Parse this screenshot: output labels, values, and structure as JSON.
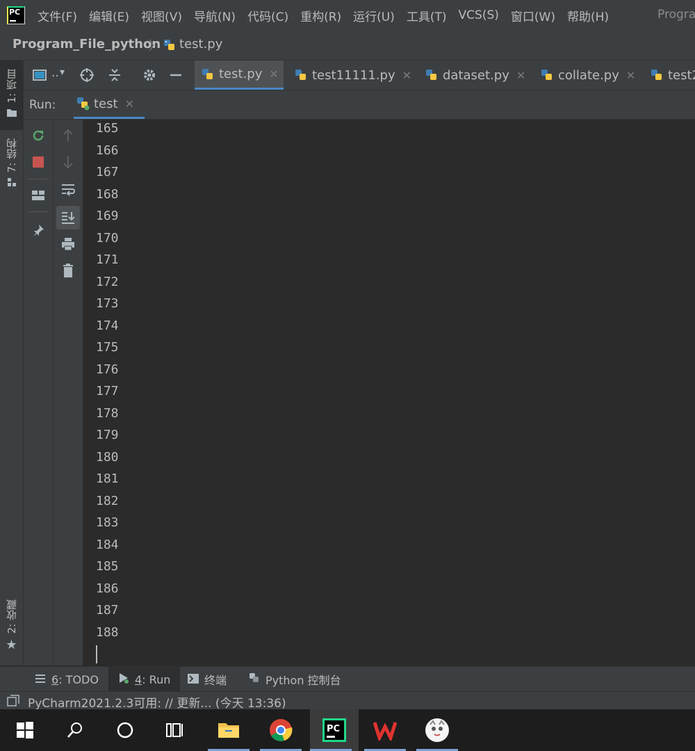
{
  "menu": {
    "items": [
      "文件(F)",
      "编辑(E)",
      "视图(V)",
      "导航(N)",
      "代码(C)",
      "重构(R)",
      "运行(U)",
      "工具(T)",
      "VCS(S)",
      "窗口(W)",
      "帮助(H)"
    ],
    "project_title": "Progra"
  },
  "breadcrumb": {
    "project": "Program_File_python",
    "file": "test.py"
  },
  "left_tools": {
    "project": "1: 项目",
    "structure": "7: 结构",
    "favorites": "2: 收藏"
  },
  "toolbar": {
    "view_mode": "..",
    "icons": [
      "target-icon",
      "collapse-icon",
      "gear-icon",
      "minimize-icon"
    ]
  },
  "editor_tabs": [
    {
      "label": "test.py",
      "active": true
    },
    {
      "label": "test11111.py",
      "active": false
    },
    {
      "label": "dataset.py",
      "active": false
    },
    {
      "label": "collate.py",
      "active": false
    },
    {
      "label": "test2",
      "active": false
    }
  ],
  "run": {
    "label": "Run:",
    "tab": "test"
  },
  "console": {
    "lines": [
      "165",
      "166",
      "167",
      "168",
      "169",
      "170",
      "171",
      "172",
      "173",
      "174",
      "175",
      "176",
      "177",
      "178",
      "179",
      "180",
      "181",
      "182",
      "183",
      "184",
      "185",
      "186",
      "187",
      "188"
    ]
  },
  "bottom_tabs": {
    "todo_num": "6",
    "todo": ": TODO",
    "run_num": "4",
    "run": ": Run",
    "terminal": "终端",
    "python_console": "Python 控制台"
  },
  "status": {
    "message": "PyCharm2021.2.3可用: // 更新... (今天 13:36)"
  },
  "colors": {
    "accent": "#4a88c7",
    "bg": "#2b2b2b",
    "panel": "#3c3f41",
    "stop": "#c75450",
    "rerun": "#59a869"
  }
}
